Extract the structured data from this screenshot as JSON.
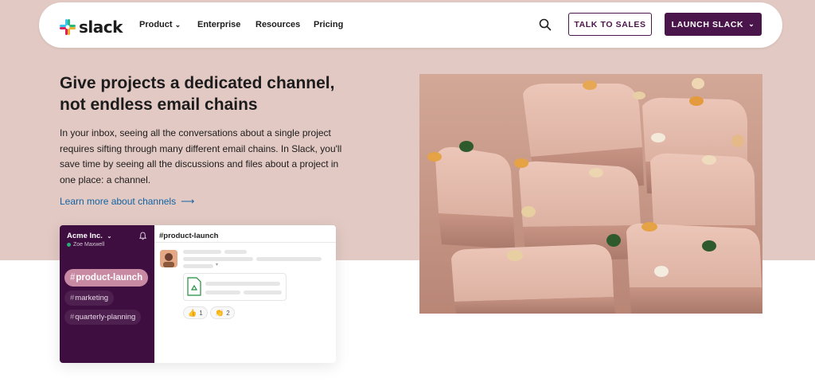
{
  "nav": {
    "logo_text": "slack",
    "links": [
      "Product",
      "Enterprise",
      "Resources",
      "Pricing"
    ],
    "talk_to_sales": "TALK TO SALES",
    "launch_slack": "LAUNCH SLACK"
  },
  "hero": {
    "headline": "Give projects a dedicated channel, not endless email chains",
    "body": "In your inbox, seeing all the conversations about a single project requires sifting through many different email chains. In Slack, you'll save time by seeing all the discussions and files about a project in one place: a channel.",
    "link": "Learn more about channels"
  },
  "mock": {
    "workspace": "Acme Inc.",
    "user": "Zoe Maxwell",
    "channels": [
      "product-launch",
      "marketing",
      "quarterly-planning"
    ],
    "channel_header": "#product-launch",
    "reactions": [
      {
        "emoji": "👍",
        "count": "1"
      },
      {
        "emoji": "👏",
        "count": "2"
      }
    ]
  },
  "colors": {
    "aubergine": "#4a154b",
    "hero_bg": "#e2c9c3",
    "link_blue": "#1264a3",
    "sidebar": "#3f0e40",
    "active_channel": "#c88aa3"
  },
  "icons": [
    "slack-logo-icon",
    "search-icon",
    "chevron-down-icon",
    "arrow-right-icon",
    "bell-icon",
    "google-sheets-file-icon"
  ]
}
